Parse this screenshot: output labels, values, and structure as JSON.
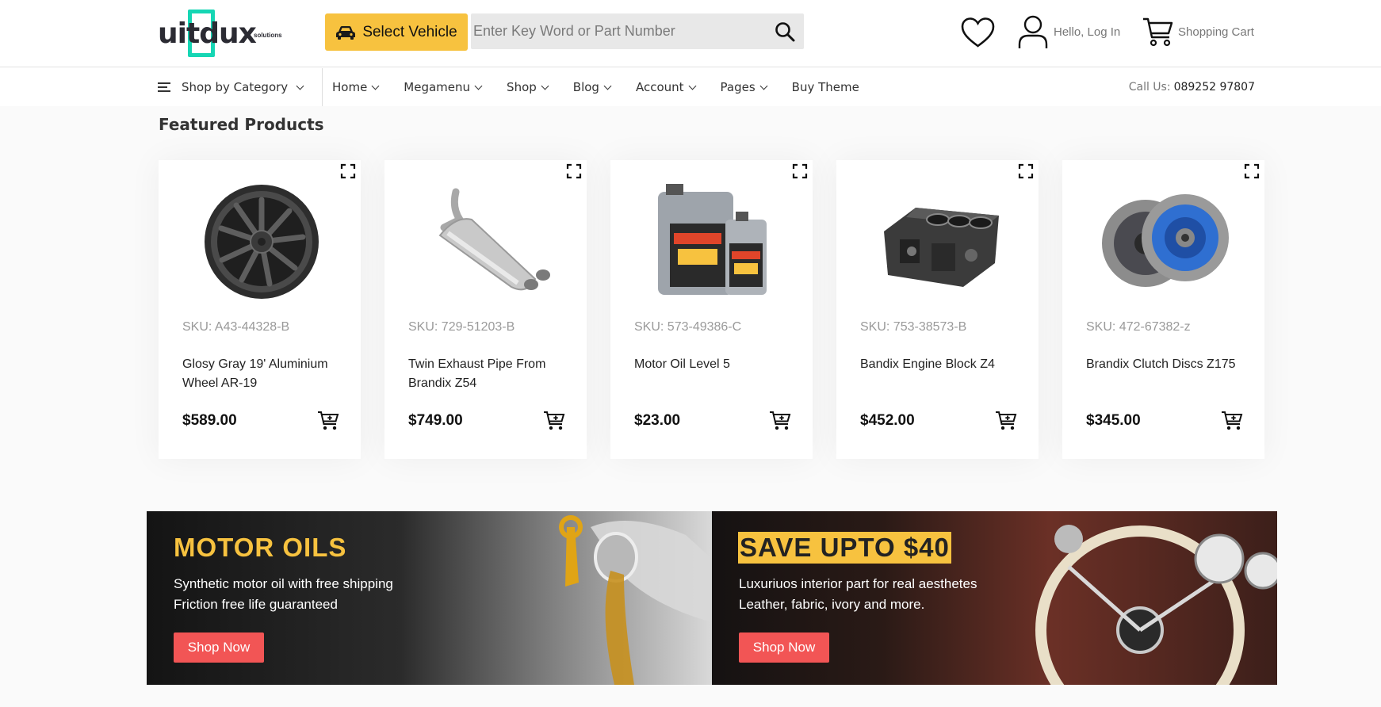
{
  "logo": {
    "text_left": "uit",
    "text_mid": "d",
    "text_right": "ux",
    "sub": "solutions"
  },
  "header": {
    "vehicle_label": "Select Vehicle",
    "search_placeholder": "Enter Key Word or Part Number",
    "account_label": "Hello, Log In",
    "cart_label": "Shopping Cart",
    "icons": [
      "car-icon",
      "search-icon",
      "heart-icon",
      "user-icon",
      "cart-icon"
    ]
  },
  "nav": {
    "category_label": "Shop by Category",
    "items": [
      {
        "label": "Home"
      },
      {
        "label": "Megamenu"
      },
      {
        "label": "Shop"
      },
      {
        "label": "Blog"
      },
      {
        "label": "Account"
      },
      {
        "label": "Pages"
      },
      {
        "label": "Buy Theme"
      }
    ],
    "call_label": "Call Us:",
    "phone": "089252 97807"
  },
  "featured": {
    "title": "Featured Products",
    "products": [
      {
        "sku": "SKU: A43-44328-B",
        "name": "Glosy Gray 19' Aluminium Wheel AR-19",
        "price": "$589.00",
        "image": "wheel"
      },
      {
        "sku": "SKU: 729-51203-B",
        "name": "Twin Exhaust Pipe From Brandix Z54",
        "price": "$749.00",
        "image": "exhaust"
      },
      {
        "sku": "SKU: 573-49386-C",
        "name": "Motor Oil Level 5",
        "price": "$23.00",
        "image": "oil"
      },
      {
        "sku": "SKU: 753-38573-B",
        "name": "Bandix Engine Block Z4",
        "price": "$452.00",
        "image": "engine"
      },
      {
        "sku": "SKU: 472-67382-z",
        "name": "Brandix Clutch Discs Z175",
        "price": "$345.00",
        "image": "clutch"
      }
    ]
  },
  "banners": [
    {
      "title": "MOTOR OILS",
      "line1": "Synthetic motor oil with free shipping",
      "line2": "Friction free life guaranteed",
      "button": "Shop Now"
    },
    {
      "title": "SAVE UPTO $40",
      "line1": "Luxuriuos interior part for real aesthetes",
      "line2": "Leather, fabric, ivory and more.",
      "button": "Shop Now"
    }
  ],
  "colors": {
    "accent": "#f7c23f",
    "button_red": "#f25555",
    "logo_teal": "#16d6b4"
  }
}
